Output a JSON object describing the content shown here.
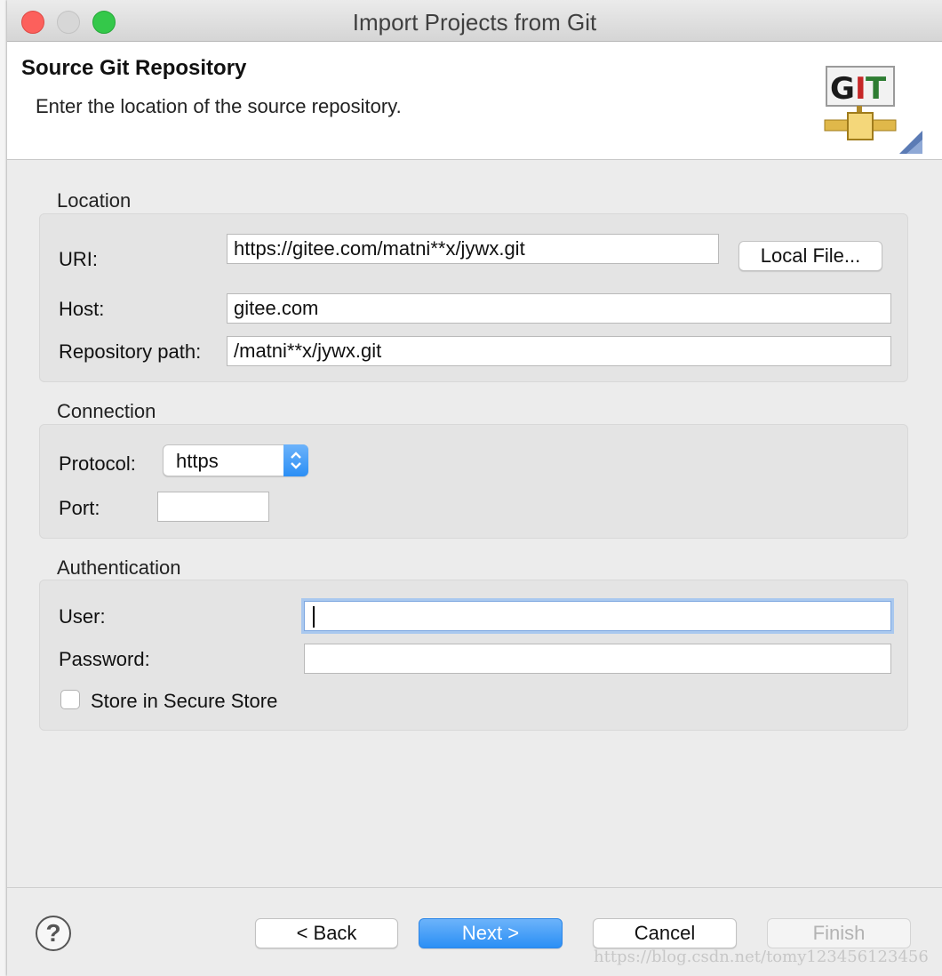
{
  "window": {
    "title": "Import Projects from Git"
  },
  "banner": {
    "title": "Source Git Repository",
    "subtitle": "Enter the location of the source repository.",
    "logo_text": "GIT",
    "logo_icon": "git-pipe-icon"
  },
  "location": {
    "section_label": "Location",
    "uri_label": "URI:",
    "uri_value": "https://gitee.com/matni**x/jywx.git",
    "local_file_button": "Local File...",
    "host_label": "Host:",
    "host_value": "gitee.com",
    "repo_path_label": "Repository path:",
    "repo_path_value": "/matni**x/jywx.git"
  },
  "connection": {
    "section_label": "Connection",
    "protocol_label": "Protocol:",
    "protocol_value": "https",
    "port_label": "Port:",
    "port_value": ""
  },
  "authentication": {
    "section_label": "Authentication",
    "user_label": "User:",
    "user_value": "",
    "password_label": "Password:",
    "password_value": "",
    "store_label": "Store in Secure Store",
    "store_checked": false
  },
  "footer": {
    "help_label": "?",
    "back_label": "< Back",
    "next_label": "Next >",
    "cancel_label": "Cancel",
    "finish_label": "Finish"
  },
  "watermark": "https://blog.csdn.net/tomy123456123456",
  "colors": {
    "accent": "#2b8ff5",
    "close": "#fc605c",
    "maximize": "#34c84a"
  }
}
